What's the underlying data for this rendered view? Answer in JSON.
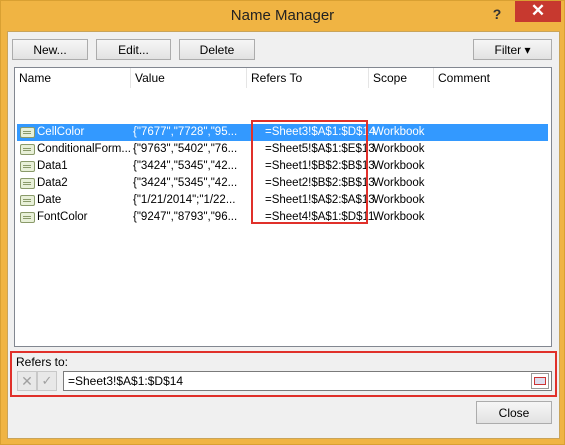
{
  "window": {
    "title": "Name Manager",
    "help": "?",
    "close": "✕"
  },
  "toolbar": {
    "new_label": "New...",
    "edit_label": "Edit...",
    "delete_label": "Delete",
    "filter_label": "Filter ▾"
  },
  "list": {
    "columns": [
      "Name",
      "Value",
      "Refers To",
      "Scope",
      "Comment"
    ],
    "rows": [
      {
        "name": "CellColor",
        "value": "{\"7677\",\"7728\",\"95...",
        "refers": "=Sheet3!$A$1:$D$14",
        "scope": "Workbook",
        "comment": "",
        "selected": true
      },
      {
        "name": "ConditionalForm...",
        "value": "{\"9763\",\"5402\",\"76...",
        "refers": "=Sheet5!$A$1:$E$13",
        "scope": "Workbook",
        "comment": "",
        "selected": false
      },
      {
        "name": "Data1",
        "value": "{\"3424\",\"5345\",\"42...",
        "refers": "=Sheet1!$B$2:$B$13",
        "scope": "Workbook",
        "comment": "",
        "selected": false
      },
      {
        "name": "Data2",
        "value": "{\"3424\",\"5345\",\"42...",
        "refers": "=Sheet2!$B$2:$B$13",
        "scope": "Workbook",
        "comment": "",
        "selected": false
      },
      {
        "name": "Date",
        "value": "{\"1/21/2014\";\"1/22...",
        "refers": "=Sheet1!$A$2:$A$13",
        "scope": "Workbook",
        "comment": "",
        "selected": false
      },
      {
        "name": "FontColor",
        "value": "{\"9247\",\"8793\",\"96...",
        "refers": "=Sheet4!$A$1:$D$11",
        "scope": "Workbook",
        "comment": "",
        "selected": false
      }
    ]
  },
  "refers_panel": {
    "label": "Refers to:",
    "value": "=Sheet3!$A$1:$D$14",
    "cancel_icon": "✕",
    "confirm_icon": "✓"
  },
  "footer": {
    "close_label": "Close"
  }
}
